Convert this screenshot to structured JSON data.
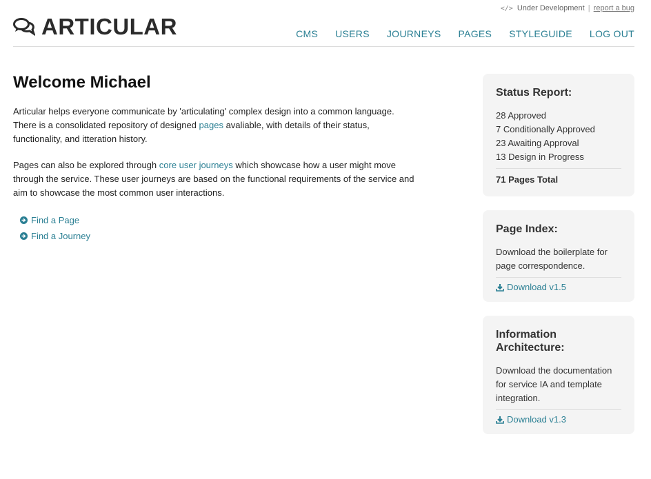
{
  "utility": {
    "status_code": "</>",
    "status": "Under Development",
    "separator": "|",
    "bug_link": "report a bug"
  },
  "brand": {
    "name": "ARTICULAR",
    "icon": "speech-bubbles-icon"
  },
  "nav": {
    "items": [
      {
        "label": "CMS"
      },
      {
        "label": "USERS"
      },
      {
        "label": "JOURNEYS"
      },
      {
        "label": "PAGES"
      },
      {
        "label": "STYLEGUIDE"
      },
      {
        "label": "LOG OUT"
      }
    ]
  },
  "main": {
    "title": "Welcome Michael",
    "para1": {
      "before": "Articular helps everyone communicate by 'articulating' complex design into a common language. There is a consolidated repository of designed ",
      "link": "pages",
      "after": " avaliable, with details of their status, functionality, and itteration history."
    },
    "para2": {
      "before": "Pages can also be explored through ",
      "link": "core user journeys",
      "after": " which showcase how a user might move through the service. These user journeys are based on the functional requirements of the service and aim to showcase the most common user interactions."
    },
    "actions": [
      {
        "label": "Find a Page",
        "icon": "circle-arrow-right-icon"
      },
      {
        "label": "Find a Journey",
        "icon": "circle-arrow-right-icon"
      }
    ]
  },
  "sidebar": {
    "status": {
      "title": "Status Report:",
      "lines": [
        "28 Approved",
        "7 Conditionally Approved",
        "23 Awaiting Approval",
        "13 Design in Progress"
      ],
      "total": "71 Pages Total"
    },
    "page_index": {
      "title": "Page Index:",
      "desc": "Download the boilerplate for page correspondence.",
      "download": "Download v1.5",
      "icon": "download-icon"
    },
    "ia": {
      "title": "Information Architecture:",
      "desc": "Download the documentation for service IA and template integration.",
      "download": "Download v1.3",
      "icon": "download-icon"
    }
  },
  "colors": {
    "accent": "#2a7f93",
    "panel_bg": "#f4f4f4"
  }
}
